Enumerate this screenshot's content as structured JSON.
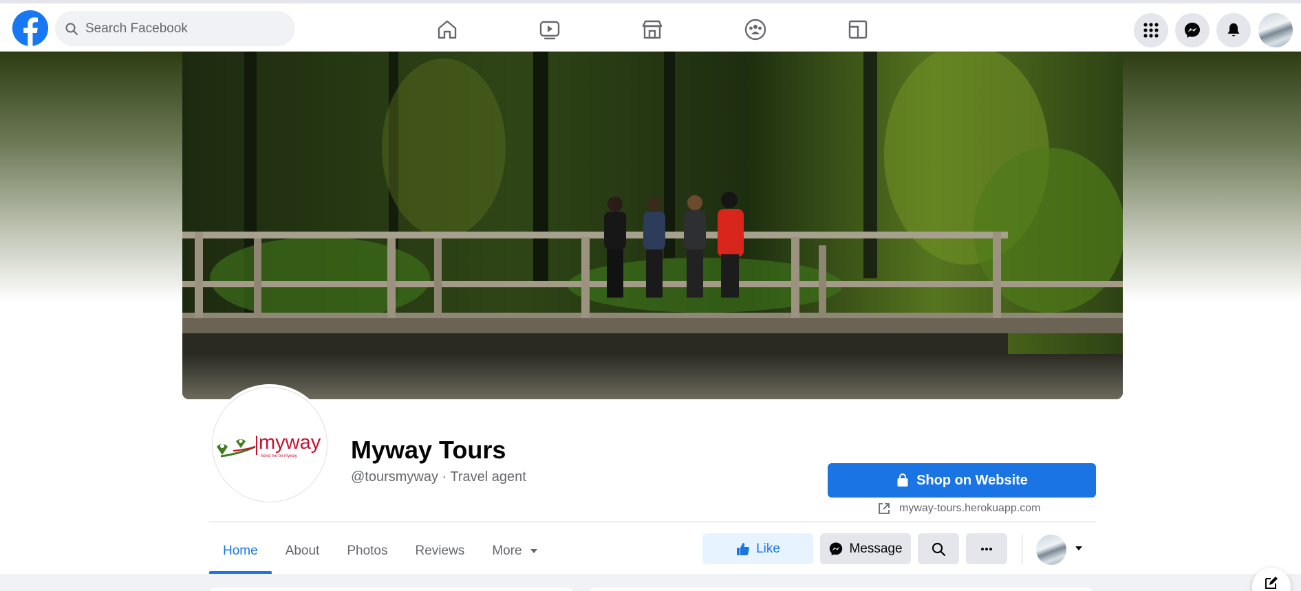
{
  "topbar": {
    "logo_icon": "facebook-logo-icon",
    "search_placeholder": "Search Facebook",
    "nav_icons": [
      "home-icon",
      "watch-icon",
      "marketplace-icon",
      "groups-icon",
      "gaming-icon"
    ],
    "right_icons": [
      "menu-grid-icon",
      "messenger-icon",
      "notifications-icon",
      "account-avatar"
    ]
  },
  "page": {
    "name": "Myway Tours",
    "meta": "@toursmyway · Travel agent",
    "logo": {
      "wordmark": "myway",
      "tagline": "Send me on myway"
    },
    "cta_label": "Shop on Website",
    "website": "myway-tours.herokuapp.com"
  },
  "tabs": [
    {
      "label": "Home",
      "active": true
    },
    {
      "label": "About",
      "active": false
    },
    {
      "label": "Photos",
      "active": false
    },
    {
      "label": "Reviews",
      "active": false
    },
    {
      "label": "More",
      "active": false
    }
  ],
  "actions": {
    "like_label": "Like",
    "message_label": "Message"
  },
  "colors": {
    "brand": "#1877f2",
    "primary_button": "#1b74e4",
    "like_bg": "#e7f3ff",
    "secondary_button": "#e4e6eb",
    "logo_red": "#c8102e",
    "logo_green": "#3f7d1e"
  }
}
